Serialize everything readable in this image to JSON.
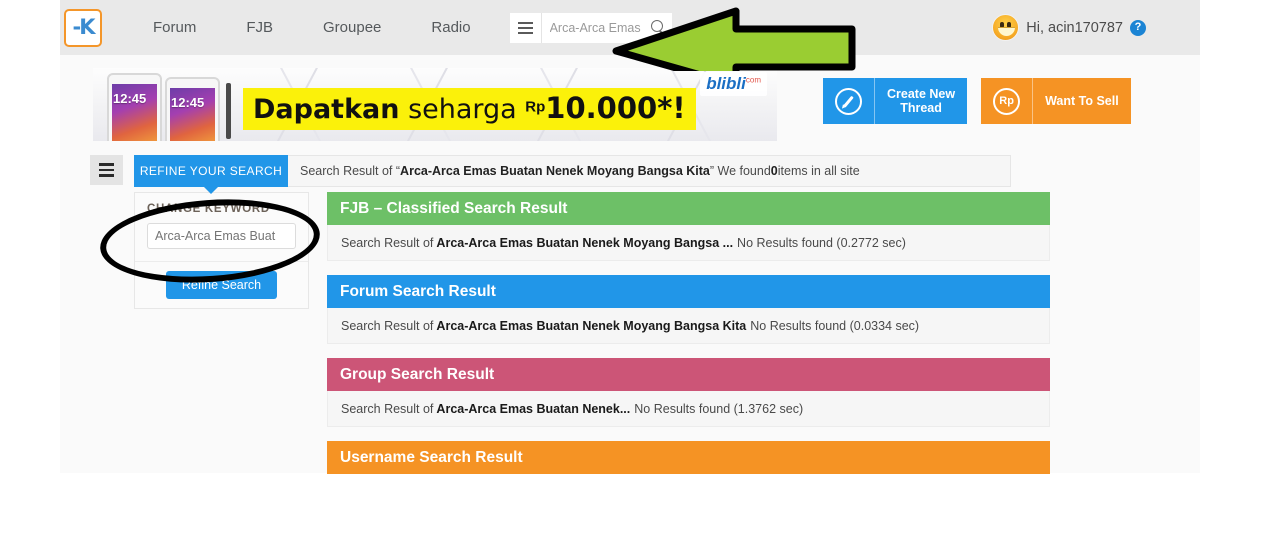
{
  "header": {
    "logo_alt": "kaskus-logo",
    "nav": [
      {
        "label": "Forum"
      },
      {
        "label": "FJB"
      },
      {
        "label": "Groupee"
      },
      {
        "label": "Radio"
      }
    ],
    "menu_icon": "hamburger-icon",
    "search": {
      "value": "Arca-Arca Emas",
      "placeholder": "Arca-Arca Emas",
      "icon": "search-icon"
    },
    "user": {
      "greeting": "Hi, acin170787",
      "avatar": "smiley-avatar",
      "help_icon": "?"
    }
  },
  "banner": {
    "promo_word1": "Dapatkan",
    "promo_word2": " seharga ",
    "promo_currency": "Rp",
    "promo_price": "10.000*!",
    "phone_time": "12:45",
    "advertiser": "blibli",
    "advertiser_tld": "com"
  },
  "actions": [
    {
      "label": "Create New\nThread",
      "icon": "pencil-icon",
      "color": "#2196e8"
    },
    {
      "label": "Want To Sell",
      "icon": "rupiah-icon",
      "icon_text": "Rp",
      "color": "#f59324"
    }
  ],
  "toolbar": {
    "sidebar_toggle_icon": "hamburger-icon",
    "refine_tab_label": "REFINE YOUR SEARCH",
    "result_prefix": "Search Result of “",
    "result_query": "Arca-Arca Emas Buatan Nenek Moyang Bangsa Kita",
    "result_mid": "” We found ",
    "result_count": "0",
    "result_suffix": " items in all site"
  },
  "sidebar": {
    "panel_title": "CHANGE KEYWORD",
    "keyword_value": "Arca-Arca Emas Buat",
    "keyword_placeholder": "Arca-Arca Emas Buat",
    "refine_button": "Refine Search"
  },
  "results": [
    {
      "title": "FJB – Classified Search Result",
      "color": "#6dc067",
      "prefix": "Search Result of",
      "query": "Arca-Arca Emas Buatan Nenek Moyang Bangsa ...",
      "status": "No Results found (0.2772 sec)"
    },
    {
      "title": "Forum Search Result",
      "color": "#2196e8",
      "prefix": "Search Result of",
      "query": "Arca-Arca Emas Buatan Nenek Moyang Bangsa Kita",
      "status": "No Results found (0.0334 sec)"
    },
    {
      "title": "Group Search Result",
      "color": "#cc5577",
      "prefix": "Search Result of",
      "query": "Arca-Arca Emas Buatan Nenek...",
      "status": "No Results found (1.3762 sec)"
    },
    {
      "title": "Username Search Result",
      "color": "#f59324",
      "prefix": "",
      "query": "",
      "status": ""
    }
  ],
  "annotations": {
    "arrow_color": "#9acd32",
    "arrow_outline": "#000000",
    "ellipse_color": "#000000"
  }
}
